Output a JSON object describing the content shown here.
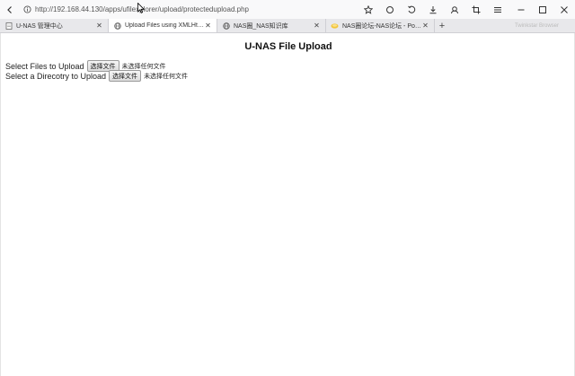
{
  "browser": {
    "url_prefix": "http://",
    "url_host": "192.168.44.130",
    "url_path": "/apps/ufileexplorer/upload/protectedupload.php",
    "url_shown": "http://192.168.44.130/apps/ufilexplorer/upload/protectedupload.php",
    "toolbar_icons": [
      "star-icon",
      "refresh-icon",
      "undo-icon",
      "download-icon",
      "user-icon",
      "crop-icon",
      "menu-icon"
    ],
    "window_controls": [
      "minimize-icon",
      "maximize-icon",
      "close-icon"
    ]
  },
  "tabs": [
    {
      "label": "U-NAS 管理中心",
      "icon": "page-icon",
      "active": false
    },
    {
      "label": "Upload Files using XMLHttpRequest",
      "icon": "globe-icon",
      "active": true
    },
    {
      "label": "NAS圈_NAS知识库",
      "icon": "globe-icon",
      "active": false
    },
    {
      "label": "NAS圈论坛-NAS论坛 - Powered by",
      "icon": "forum-icon",
      "active": false
    }
  ],
  "tab_ghost_text": "Twinkstar Browser",
  "page": {
    "title": "U-NAS File Upload",
    "files_label": "Select Files to Upload",
    "dir_label": "Select a Direcotry to Upload",
    "choose_button": "选择文件",
    "no_file": "未选择任何文件"
  },
  "colors": {
    "toolbar_bg": "#f9f9fa",
    "tabstrip_bg": "#e8e8eb",
    "active_tab_bg": "#ffffff"
  }
}
